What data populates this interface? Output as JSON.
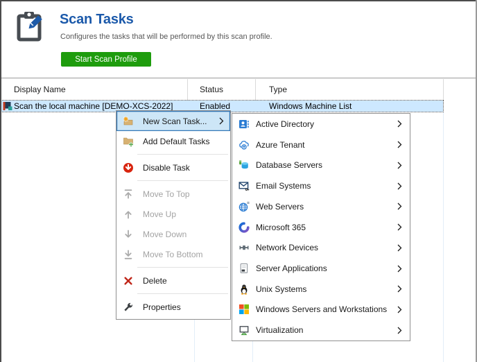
{
  "hero": {
    "title": "Scan Tasks",
    "subtitle": "Configures the tasks that will be performed by this scan profile.",
    "start_button_label": "Start Scan Profile",
    "icon": "clipboard-pencil"
  },
  "colors": {
    "title_blue": "#1b59aa",
    "button_green": "#1e9c0d",
    "row_selection_bg": "#cde8ff",
    "menu_highlight_bg": "#cde6f7",
    "menu_highlight_border": "#3579b8",
    "menu_border": "#8f8f8f"
  },
  "grid": {
    "columns": [
      {
        "label": "Display Name"
      },
      {
        "label": "Status"
      },
      {
        "label": "Type"
      }
    ],
    "rows": [
      {
        "icon": "windows-machine-list",
        "display_name": "Scan the local machine [DEMO-XCS-2022]",
        "status": "Enabled",
        "type": "Windows Machine List",
        "selected": true
      }
    ]
  },
  "context_menu": {
    "items": [
      {
        "label": "New Scan Task...",
        "icon": "new-scan-task",
        "highlighted": true,
        "has_submenu": true
      },
      {
        "label": "Add Default Tasks",
        "icon": "add-default-tasks"
      },
      {
        "type": "separator"
      },
      {
        "label": "Disable Task",
        "icon": "disable-task"
      },
      {
        "type": "separator"
      },
      {
        "label": "Move To Top",
        "icon": "move-to-top",
        "disabled": true
      },
      {
        "label": "Move Up",
        "icon": "move-up",
        "disabled": true
      },
      {
        "label": "Move Down",
        "icon": "move-down",
        "disabled": true
      },
      {
        "label": "Move To Bottom",
        "icon": "move-to-bottom",
        "disabled": true
      },
      {
        "type": "separator"
      },
      {
        "label": "Delete",
        "icon": "delete"
      },
      {
        "type": "separator"
      },
      {
        "label": "Properties",
        "icon": "properties"
      }
    ]
  },
  "submenu": {
    "items": [
      {
        "label": "Active Directory",
        "icon": "active-directory",
        "has_submenu": true
      },
      {
        "label": "Azure Tenant",
        "icon": "azure-tenant",
        "has_submenu": true
      },
      {
        "label": "Database Servers",
        "icon": "database-servers",
        "has_submenu": true
      },
      {
        "label": "Email Systems",
        "icon": "email-systems",
        "has_submenu": true
      },
      {
        "label": "Web Servers",
        "icon": "web-servers",
        "has_submenu": true
      },
      {
        "label": "Microsoft 365",
        "icon": "microsoft-365",
        "has_submenu": true
      },
      {
        "label": "Network Devices",
        "icon": "network-devices",
        "has_submenu": true
      },
      {
        "label": "Server Applications",
        "icon": "server-applications",
        "has_submenu": true
      },
      {
        "label": "Unix Systems",
        "icon": "unix-systems",
        "has_submenu": true
      },
      {
        "label": "Windows Servers and Workstations",
        "icon": "windows-servers",
        "has_submenu": true
      },
      {
        "label": "Virtualization",
        "icon": "virtualization",
        "has_submenu": true
      }
    ]
  }
}
